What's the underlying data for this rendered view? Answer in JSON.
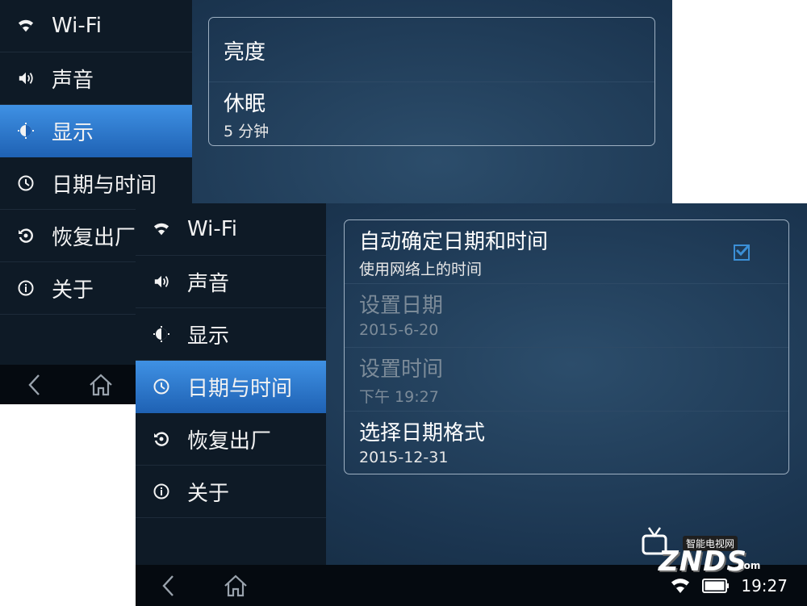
{
  "back_screen": {
    "sidebar": {
      "items": [
        {
          "label": "Wi-Fi",
          "icon": "wifi-icon"
        },
        {
          "label": "声音",
          "icon": "speaker-icon"
        },
        {
          "label": "显示",
          "icon": "display-icon",
          "active": true
        },
        {
          "label": "日期与时间",
          "icon": "clock-icon"
        },
        {
          "label": "恢复出厂",
          "icon": "restore-icon"
        },
        {
          "label": "关于",
          "icon": "info-icon"
        }
      ]
    },
    "panel": {
      "rows": [
        {
          "title": "亮度"
        },
        {
          "title": "休眠",
          "subtitle": "5  分钟"
        }
      ]
    },
    "navbar": {
      "back_icon": "back-icon",
      "home_icon": "home-icon"
    }
  },
  "front_screen": {
    "sidebar": {
      "items": [
        {
          "label": "Wi-Fi",
          "icon": "wifi-icon"
        },
        {
          "label": "声音",
          "icon": "speaker-icon"
        },
        {
          "label": "显示",
          "icon": "display-icon"
        },
        {
          "label": "日期与时间",
          "icon": "clock-icon",
          "active": true
        },
        {
          "label": "恢复出厂",
          "icon": "restore-icon"
        },
        {
          "label": "关于",
          "icon": "info-icon"
        }
      ]
    },
    "panel": {
      "rows": [
        {
          "title": "自动确定日期和时间",
          "subtitle": "使用网络上的时间",
          "checked": true
        },
        {
          "title": "设置日期",
          "subtitle": "2015-6-20",
          "disabled": true
        },
        {
          "title": "设置时间",
          "subtitle": "下午  19:27",
          "disabled": true
        },
        {
          "title": "选择日期格式",
          "subtitle": "2015-12-31"
        }
      ]
    },
    "navbar": {
      "back_icon": "back-icon",
      "home_icon": "home-icon"
    },
    "status": {
      "time": "19:27",
      "icons": [
        "wifi-icon",
        "battery-icon"
      ]
    }
  },
  "watermark": {
    "sub": "智能电视网",
    "main": "ZNDS",
    "suffix": ".com"
  },
  "colors": {
    "accent": "#2f7fd3",
    "sidebar_bg": "#0e1a26",
    "panel_border": "#9eb0c2",
    "disabled_text": "#7c8b99"
  }
}
